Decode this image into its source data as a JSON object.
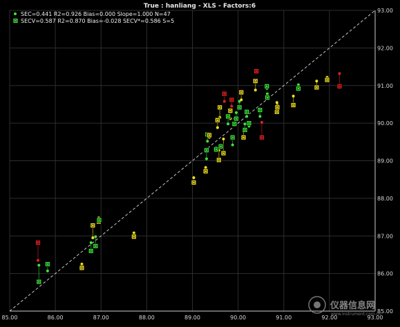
{
  "chart_data": {
    "type": "scatter",
    "title": "True : hanliang - XLS - Factors:6",
    "xlim": [
      85.0,
      93.0
    ],
    "ylim": [
      85.0,
      93.0
    ],
    "x_ticks": [
      "85.00",
      "86.00",
      "87.00",
      "88.00",
      "89.00",
      "90.00",
      "91.00",
      "92.00",
      "93.00"
    ],
    "y_ticks": [
      "85.00",
      "86.00",
      "87.00",
      "88.00",
      "89.00",
      "90.00",
      "91.00",
      "92.00",
      "93.00"
    ],
    "grid": true,
    "legend_position": "top-left",
    "reference_line": "y = x",
    "legend": [
      {
        "marker": "dot",
        "color": "#3de23d",
        "text": "SEC=0.441  R2=0.926  Bias=0.000  Slope=1.000  N=47"
      },
      {
        "marker": "square",
        "color": "#3de23d",
        "text": "SECV=0.587  R2=0.870  Bias=-0.028  SECV*=0.586  S=5"
      }
    ],
    "colors": {
      "good": "#3de23d",
      "warning": "#f0e020",
      "outlier": "#e02020",
      "background": "#000000",
      "grid": "#2e2e2e",
      "diagonal": "#c8c8c8"
    },
    "points": [
      {
        "x": 85.62,
        "cal": 86.35,
        "val": 86.82,
        "status": "outlier"
      },
      {
        "x": 85.64,
        "cal": 86.22,
        "val": 85.78,
        "status": "good"
      },
      {
        "x": 85.83,
        "cal": 86.07,
        "val": 86.25,
        "status": "good"
      },
      {
        "x": 86.58,
        "cal": 86.25,
        "val": 86.15,
        "status": "warning"
      },
      {
        "x": 86.78,
        "cal": 86.82,
        "val": 86.6,
        "status": "good"
      },
      {
        "x": 86.82,
        "cal": 86.95,
        "val": 87.28,
        "status": "warning"
      },
      {
        "x": 86.88,
        "cal": 86.98,
        "val": 86.73,
        "status": "good"
      },
      {
        "x": 86.95,
        "cal": 87.48,
        "val": 87.38,
        "status": "warning"
      },
      {
        "x": 86.96,
        "cal": 87.35,
        "val": 87.42,
        "status": "good"
      },
      {
        "x": 87.72,
        "cal": 87.08,
        "val": 86.98,
        "status": "warning"
      },
      {
        "x": 89.03,
        "cal": 88.55,
        "val": 88.42,
        "status": "warning"
      },
      {
        "x": 89.29,
        "cal": 88.82,
        "val": 88.72,
        "status": "warning"
      },
      {
        "x": 89.31,
        "cal": 89.05,
        "val": 89.28,
        "status": "good"
      },
      {
        "x": 89.33,
        "cal": 89.52,
        "val": 89.7,
        "status": "good"
      },
      {
        "x": 89.37,
        "cal": 89.62,
        "val": 89.68,
        "status": "warning"
      },
      {
        "x": 89.52,
        "cal": 89.35,
        "val": 89.3,
        "status": "good"
      },
      {
        "x": 89.55,
        "cal": 89.88,
        "val": 90.08,
        "status": "warning"
      },
      {
        "x": 89.58,
        "cal": 89.28,
        "val": 89.02,
        "status": "warning"
      },
      {
        "x": 89.6,
        "cal": 90.15,
        "val": 90.42,
        "status": "warning"
      },
      {
        "x": 89.62,
        "cal": 89.42,
        "val": 89.38,
        "status": "good"
      },
      {
        "x": 89.68,
        "cal": 89.58,
        "val": 89.2,
        "status": "warning"
      },
      {
        "x": 89.7,
        "cal": 90.58,
        "val": 90.78,
        "status": "outlier"
      },
      {
        "x": 89.78,
        "cal": 89.98,
        "val": 90.18,
        "status": "good"
      },
      {
        "x": 89.83,
        "cal": 90.12,
        "val": 90.33,
        "status": "warning"
      },
      {
        "x": 89.86,
        "cal": 90.45,
        "val": 90.62,
        "status": "outlier"
      },
      {
        "x": 89.88,
        "cal": 89.42,
        "val": 89.62,
        "status": "good"
      },
      {
        "x": 89.92,
        "cal": 90.12,
        "val": 89.98,
        "status": "good"
      },
      {
        "x": 89.96,
        "cal": 90.28,
        "val": 90.12,
        "status": "good"
      },
      {
        "x": 90.03,
        "cal": 90.58,
        "val": 90.42,
        "status": "good"
      },
      {
        "x": 90.07,
        "cal": 90.62,
        "val": 90.82,
        "status": "warning"
      },
      {
        "x": 90.12,
        "cal": 89.78,
        "val": 89.62,
        "status": "warning"
      },
      {
        "x": 90.15,
        "cal": 89.98,
        "val": 89.82,
        "status": "good"
      },
      {
        "x": 90.19,
        "cal": 90.18,
        "val": 90.3,
        "status": "good"
      },
      {
        "x": 90.24,
        "cal": 89.92,
        "val": 90.0,
        "status": "good"
      },
      {
        "x": 90.38,
        "cal": 90.88,
        "val": 91.12,
        "status": "warning"
      },
      {
        "x": 90.4,
        "cal": 91.42,
        "val": 91.38,
        "status": "outlier"
      },
      {
        "x": 90.48,
        "cal": 90.18,
        "val": 90.35,
        "status": "good"
      },
      {
        "x": 90.52,
        "cal": 90.02,
        "val": 89.62,
        "status": "outlier"
      },
      {
        "x": 90.63,
        "cal": 90.92,
        "val": 90.98,
        "status": "good"
      },
      {
        "x": 90.64,
        "cal": 90.78,
        "val": 90.68,
        "status": "good"
      },
      {
        "x": 90.85,
        "cal": 90.55,
        "val": 90.3,
        "status": "warning"
      },
      {
        "x": 90.86,
        "cal": 90.48,
        "val": 90.42,
        "status": "warning"
      },
      {
        "x": 91.21,
        "cal": 90.72,
        "val": 90.48,
        "status": "warning"
      },
      {
        "x": 91.32,
        "cal": 91.02,
        "val": 90.92,
        "status": "good"
      },
      {
        "x": 91.72,
        "cal": 91.12,
        "val": 90.95,
        "status": "warning"
      },
      {
        "x": 91.95,
        "cal": 91.22,
        "val": 91.15,
        "status": "warning"
      },
      {
        "x": 92.22,
        "cal": 91.32,
        "val": 90.98,
        "status": "outlier"
      }
    ]
  },
  "watermark": {
    "brand": "仪器信息网",
    "url": "www.instrument.com.cn"
  }
}
